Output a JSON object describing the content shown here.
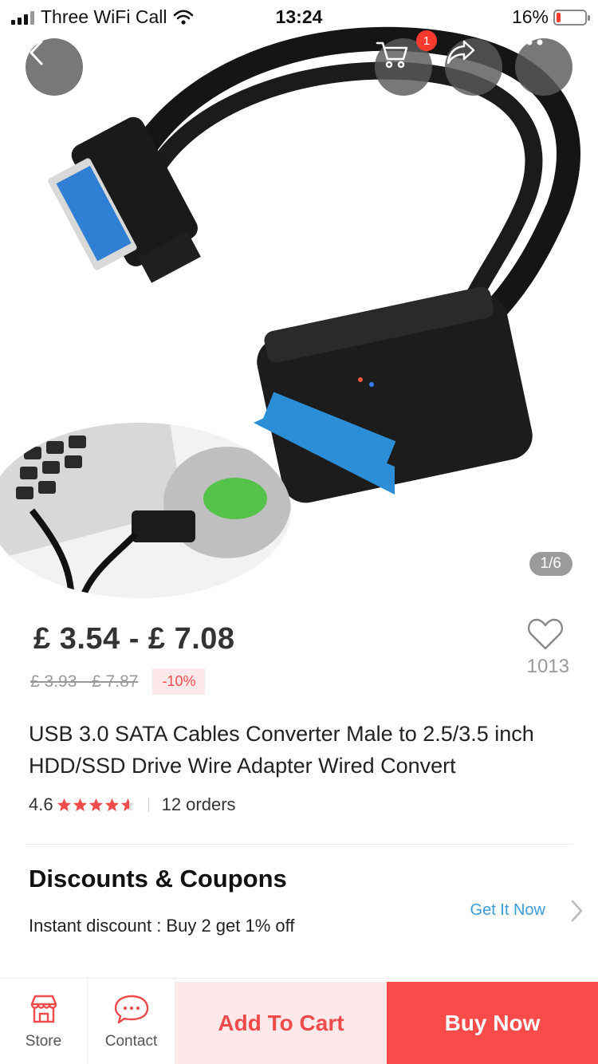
{
  "status_bar": {
    "carrier": "Three WiFi Call",
    "time": "13:24",
    "battery": "16%",
    "battery_level": 0.16
  },
  "header": {
    "cart_badge": "1"
  },
  "gallery": {
    "counter": "1/6"
  },
  "product": {
    "price_range": "£ 3.54 -  £ 7.08",
    "original_price": "£ 3.93 - £ 7.87",
    "discount": "-10%",
    "wishlist_count": "1013",
    "title": "USB 3.0 SATA Cables Converter Male to 2.5/3.5 inch HDD/SSD Drive Wire Adapter Wired Convert",
    "rating": "4.6",
    "rating_value": 4.6,
    "orders": "12 orders"
  },
  "coupons": {
    "heading": "Discounts & Coupons",
    "text": "Instant discount : Buy 2 get 1% off",
    "action": "Get It Now"
  },
  "bottom_bar": {
    "store": "Store",
    "contact": "Contact",
    "add_to_cart": "Add To Cart",
    "buy_now": "Buy Now"
  },
  "colors": {
    "accent": "#fa4b4b",
    "accent_light": "#fde9e9",
    "link": "#3d9bd8",
    "star": "#f04b4b"
  },
  "icons": [
    "back-icon",
    "cart-icon",
    "share-icon",
    "more-icon",
    "heart-icon",
    "star-icon",
    "chevron-right-icon",
    "store-icon",
    "chat-icon"
  ]
}
